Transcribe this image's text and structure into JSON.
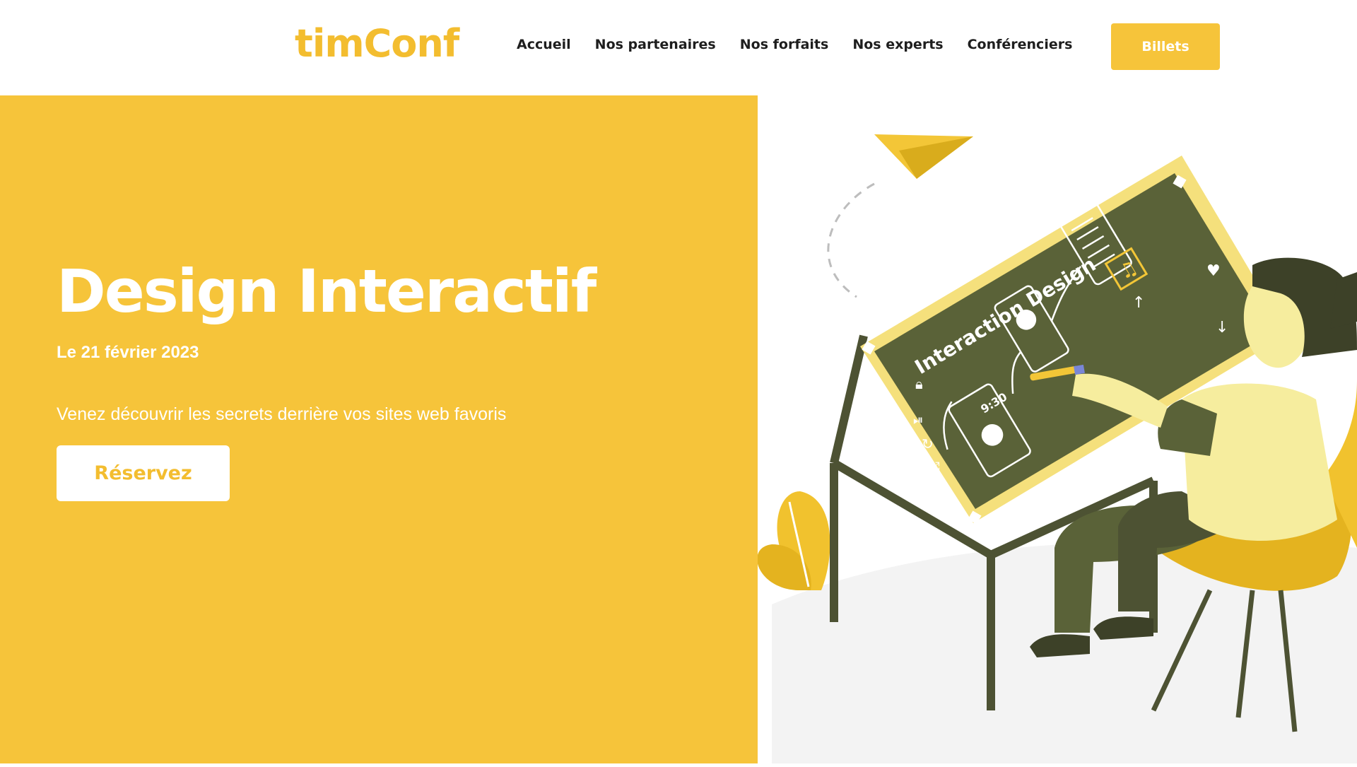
{
  "header": {
    "logo": "timConf",
    "nav": [
      "Accueil",
      "Nos partenaires",
      "Nos forfaits",
      "Nos experts",
      "Conférenciers"
    ],
    "tickets_label": "Billets"
  },
  "hero": {
    "title": "Design Interactif",
    "date": "Le 21 février 2023",
    "subtitle": "Venez découvrir les secrets derrière vos sites web favoris",
    "cta_label": "Réservez"
  },
  "illustration": {
    "board_title": "Interaction Design",
    "time": "9:30"
  },
  "colors": {
    "accent": "#f6c43a",
    "dark_olive": "#5a6035",
    "board_frame": "#f3dd6d"
  },
  "icons": [
    "paper-plane-icon",
    "music-note-icon",
    "heart-icon",
    "lock-icon",
    "image-icon",
    "play-pause-icon",
    "shuffle-icon",
    "repeat-icon",
    "arrow-icon"
  ]
}
